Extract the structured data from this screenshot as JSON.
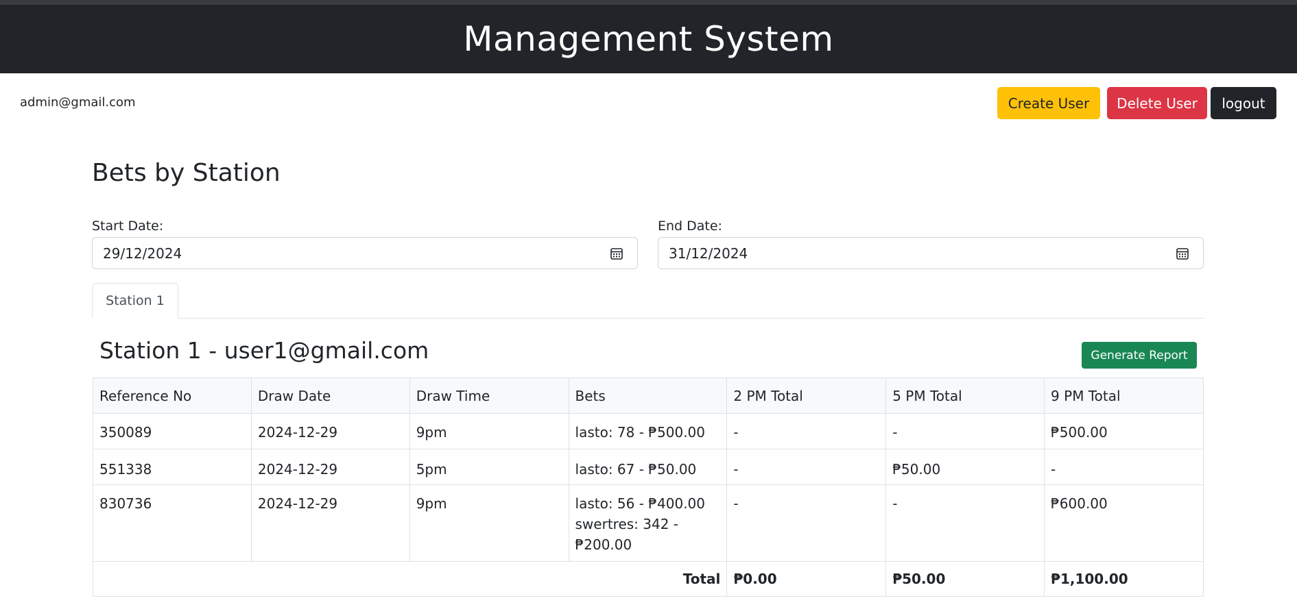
{
  "header": {
    "title": "Management System"
  },
  "user": {
    "email": "admin@gmail.com"
  },
  "actions": {
    "create_user": "Create User",
    "delete_user": "Delete User",
    "logout": "logout"
  },
  "page": {
    "title": "Bets by Station"
  },
  "filters": {
    "start_label": "Start Date:",
    "start_value": "29/12/2024",
    "end_label": "End Date:",
    "end_value": "31/12/2024"
  },
  "tabs": [
    {
      "label": "Station 1"
    }
  ],
  "station": {
    "heading": "Station 1 - user1@gmail.com",
    "report_button": "Generate Report"
  },
  "table": {
    "headers": [
      "Reference No",
      "Draw Date",
      "Draw Time",
      "Bets",
      "2 PM Total",
      "5 PM Total",
      "9 PM Total"
    ],
    "rows": [
      {
        "ref": "350089",
        "date": "2024-12-29",
        "time": "9pm",
        "bets": [
          "lasto: 78 - ₱500.00"
        ],
        "pm2": "-",
        "pm5": "-",
        "pm9": "₱500.00"
      },
      {
        "ref": "551338",
        "date": "2024-12-29",
        "time": "5pm",
        "bets": [
          "lasto: 67 - ₱50.00"
        ],
        "pm2": "-",
        "pm5": "₱50.00",
        "pm9": "-"
      },
      {
        "ref": "830736",
        "date": "2024-12-29",
        "time": "9pm",
        "bets": [
          "lasto: 56 - ₱400.00",
          "swertres: 342 -",
          "₱200.00"
        ],
        "pm2": "-",
        "pm5": "-",
        "pm9": "₱600.00"
      }
    ],
    "total": {
      "label": "Total",
      "pm2": "₱0.00",
      "pm5": "₱50.00",
      "pm9": "₱1,100.00"
    }
  },
  "icons": {
    "calendar": "calendar-icon"
  },
  "colors": {
    "header_bg": "#212529",
    "create": "#ffc107",
    "delete": "#dc3545",
    "logout": "#212529",
    "report": "#198754"
  }
}
